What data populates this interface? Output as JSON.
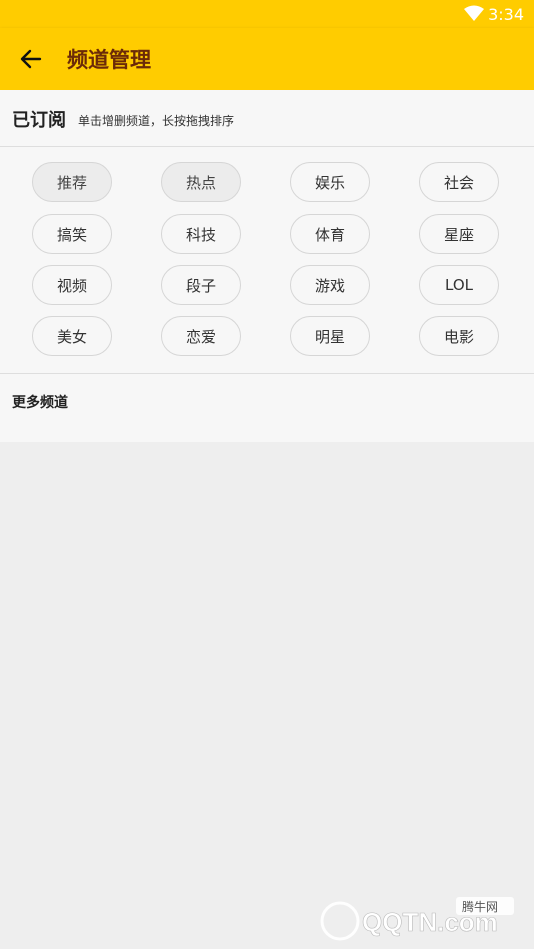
{
  "status": {
    "time": "3:34"
  },
  "toolbar": {
    "title": "频道管理"
  },
  "subscribed": {
    "heading": "已订阅",
    "hint": "单击增删频道，长按拖拽排序"
  },
  "channels": [
    "推荐",
    "热点",
    "娱乐",
    "社会",
    "搞笑",
    "科技",
    "体育",
    "星座",
    "视频",
    "段子",
    "游戏",
    "LOL",
    "美女",
    "恋爱",
    "明星",
    "电影"
  ],
  "more": {
    "heading": "更多频道"
  },
  "watermark": {
    "brand": "QQTN.com",
    "cn": "腾牛网"
  },
  "colors": {
    "accent": "#ffcc00",
    "title_text": "#6b2a08",
    "background": "#eeeeee"
  }
}
